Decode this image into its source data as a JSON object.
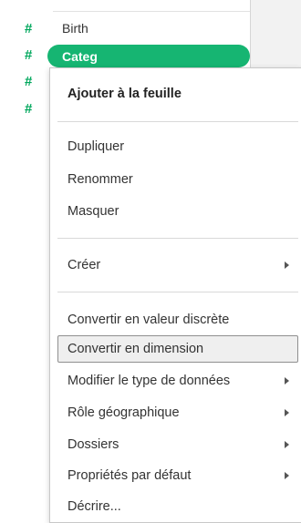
{
  "data_pane": {
    "fields": [
      {
        "icon": "#",
        "label": "Birth"
      },
      {
        "icon": "#",
        "label": "Categ"
      },
      {
        "icon": "#",
        "label": ""
      },
      {
        "icon": "#",
        "label": ""
      }
    ],
    "accent_color": "#16b572",
    "icon_color": "#00a75c"
  },
  "context_menu": {
    "items": [
      {
        "label": "Ajouter à la feuille"
      },
      {
        "label": "Dupliquer"
      },
      {
        "label": "Renommer"
      },
      {
        "label": "Masquer"
      },
      {
        "label": "Créer"
      },
      {
        "label": "Convertir en valeur discrète"
      },
      {
        "label": "Convertir en dimension"
      },
      {
        "label": "Modifier le type de données"
      },
      {
        "label": "Rôle géographique"
      },
      {
        "label": "Dossiers"
      },
      {
        "label": "Propriétés par défaut"
      },
      {
        "label": "Décrire..."
      }
    ]
  }
}
